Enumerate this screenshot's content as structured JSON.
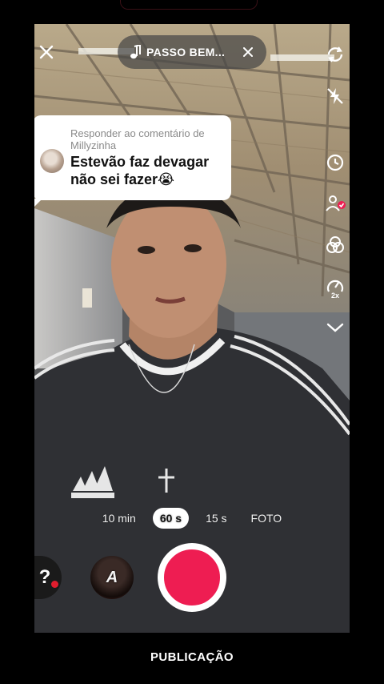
{
  "sound": {
    "title": "PASSO BEM..."
  },
  "reply": {
    "header": "Responder ao comentário de Millyzinha",
    "text": "Estevão faz devagar não sei fazer😭"
  },
  "modes": [
    {
      "label": "10 min",
      "active": false
    },
    {
      "label": "60 s",
      "active": true
    },
    {
      "label": "15 s",
      "active": false
    },
    {
      "label": "FOTO",
      "active": false
    }
  ],
  "effects": {
    "left_glyph": "?",
    "selected_effect_letter": "A"
  },
  "tools": {
    "speed_badge": "2x"
  },
  "bottom_tab": "PUBLICAÇÃO",
  "colors": {
    "record": "#ee1d52",
    "background": "#000000"
  }
}
